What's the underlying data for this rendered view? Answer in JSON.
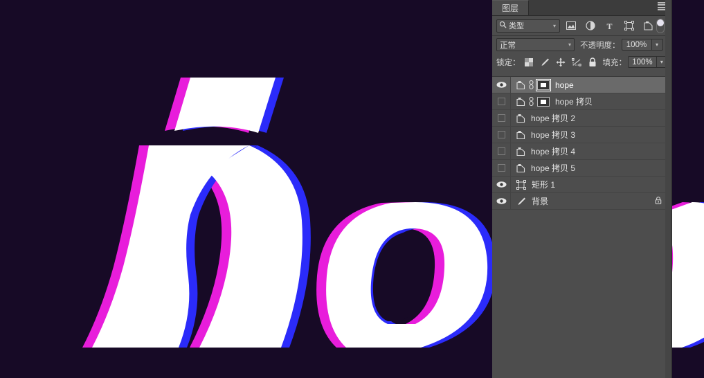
{
  "app": {
    "background_color": "#170a26",
    "panel_bg": "#4d4d4d",
    "accent_magenta": "#e81ddb",
    "accent_blue": "#2b2bfa",
    "letter_fill": "#ffffff"
  },
  "artwork": {
    "text": "hope",
    "description": "italic-chromatic-aberration-wordmark",
    "letters": [
      "h",
      "o",
      "p"
    ],
    "stroke_magenta": "#e81ddb",
    "stroke_blue": "#2b2bfa",
    "fill": "#ffffff"
  },
  "panel": {
    "tab_label": "图层",
    "menu_icon": "hamburger-menu-icon",
    "filter": {
      "kind_label": "类型",
      "search_icon": "search-icon",
      "chevron": "▾",
      "icons": [
        {
          "name": "pixel-layer-filter-icon",
          "glyph": "image"
        },
        {
          "name": "adjustment-layer-filter-icon",
          "glyph": "half-circle"
        },
        {
          "name": "type-layer-filter-icon",
          "glyph": "T"
        },
        {
          "name": "shape-layer-filter-icon",
          "glyph": "shape"
        },
        {
          "name": "smart-object-filter-icon",
          "glyph": "smart-object"
        }
      ],
      "toggle_name": "filter-enable-toggle"
    },
    "blend": {
      "mode": "正常",
      "chevron": "▾",
      "opacity_label": "不透明度：",
      "opacity_value": "100%",
      "opacity_stepper": "▾"
    },
    "lock": {
      "label": "锁定：",
      "icons": [
        {
          "name": "lock-transparent-pixels-icon",
          "glyph": "checker"
        },
        {
          "name": "lock-image-pixels-icon",
          "glyph": "brush"
        },
        {
          "name": "lock-position-icon",
          "glyph": "move"
        },
        {
          "name": "lock-artboard-nesting-icon",
          "glyph": "artboard"
        },
        {
          "name": "lock-all-icon",
          "glyph": "padlock"
        }
      ],
      "fill_label": "填充：",
      "fill_value": "100%",
      "fill_stepper": "▾"
    },
    "layers": [
      {
        "name": "hope",
        "visible": true,
        "selected": true,
        "smart_object": true,
        "linked": true,
        "mask": true,
        "type": "smart-object",
        "locked": false
      },
      {
        "name": "hope 拷贝",
        "visible": false,
        "selected": false,
        "smart_object": true,
        "linked": true,
        "mask": true,
        "type": "smart-object",
        "locked": false
      },
      {
        "name": "hope 拷贝 2",
        "visible": false,
        "selected": false,
        "smart_object": true,
        "linked": false,
        "mask": false,
        "type": "smart-object",
        "locked": false
      },
      {
        "name": "hope 拷贝 3",
        "visible": false,
        "selected": false,
        "smart_object": true,
        "linked": false,
        "mask": false,
        "type": "smart-object",
        "locked": false
      },
      {
        "name": "hope 拷贝 4",
        "visible": false,
        "selected": false,
        "smart_object": true,
        "linked": false,
        "mask": false,
        "type": "smart-object",
        "locked": false
      },
      {
        "name": "hope 拷贝 5",
        "visible": false,
        "selected": false,
        "smart_object": true,
        "linked": false,
        "mask": false,
        "type": "smart-object",
        "locked": false
      },
      {
        "name": "矩形 1",
        "visible": true,
        "selected": false,
        "smart_object": false,
        "linked": false,
        "mask": false,
        "type": "shape",
        "locked": false
      },
      {
        "name": "背景",
        "visible": true,
        "selected": false,
        "smart_object": false,
        "linked": false,
        "mask": false,
        "type": "background",
        "locked": true
      }
    ]
  }
}
